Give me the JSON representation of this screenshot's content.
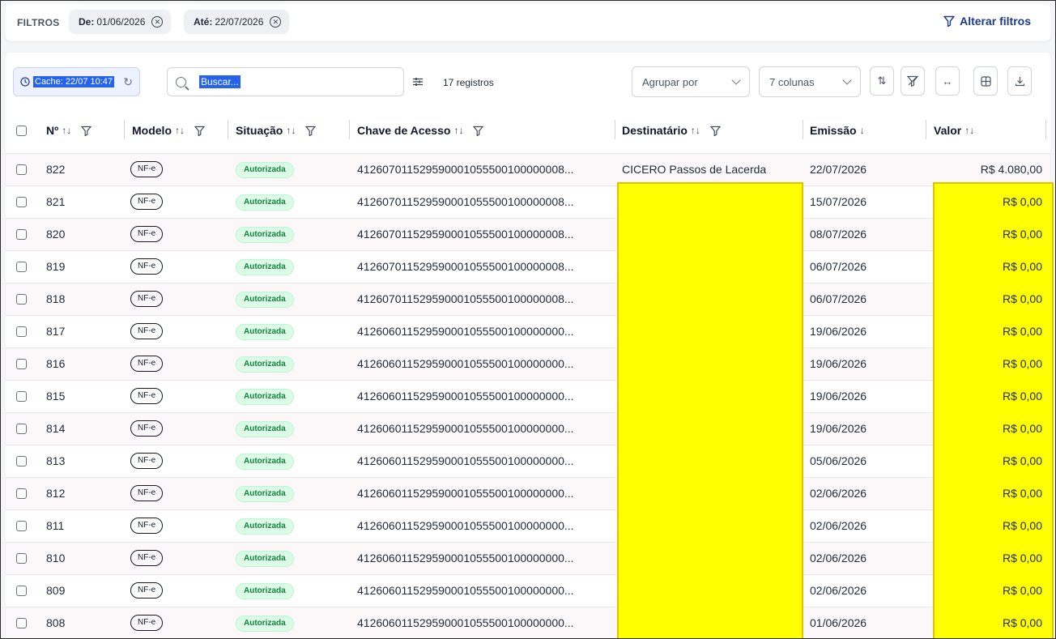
{
  "filters": {
    "label": "FILTROS",
    "chips": [
      {
        "prefix": "De:",
        "value": "01/06/2026"
      },
      {
        "prefix": "Até:",
        "value": "22/07/2026"
      }
    ],
    "change_label": "Alterar filtros"
  },
  "toolbar": {
    "cache_label": "Cache: 22/07 10:47",
    "search_placeholder": "Buscar...",
    "record_count": "17 registros",
    "group_by": "Agrupar por",
    "columns": "7 colunas"
  },
  "columns": [
    "Nº",
    "Modelo",
    "Situação",
    "Chave de Acesso",
    "Destinatário",
    "Emissão",
    "Valor"
  ],
  "rows": [
    {
      "num": "822",
      "modelo": "NF-e",
      "situacao": "Autorizada",
      "chave": "412607011529590001055500100000008...",
      "destinatario": "CICERO Passos de Lacerda",
      "emissao": "22/07/2026",
      "valor": "R$ 4.080,00"
    },
    {
      "num": "821",
      "modelo": "NF-e",
      "situacao": "Autorizada",
      "chave": "412607011529590001055500100000008...",
      "destinatario": "",
      "emissao": "15/07/2026",
      "valor": "R$ 0,00"
    },
    {
      "num": "820",
      "modelo": "NF-e",
      "situacao": "Autorizada",
      "chave": "412607011529590001055500100000008...",
      "destinatario": "",
      "emissao": "08/07/2026",
      "valor": "R$ 0,00"
    },
    {
      "num": "819",
      "modelo": "NF-e",
      "situacao": "Autorizada",
      "chave": "412607011529590001055500100000008...",
      "destinatario": "",
      "emissao": "06/07/2026",
      "valor": "R$ 0,00"
    },
    {
      "num": "818",
      "modelo": "NF-e",
      "situacao": "Autorizada",
      "chave": "412607011529590001055500100000008...",
      "destinatario": "",
      "emissao": "06/07/2026",
      "valor": "R$ 0,00"
    },
    {
      "num": "817",
      "modelo": "NF-e",
      "situacao": "Autorizada",
      "chave": "412606011529590001055500100000000...",
      "destinatario": "",
      "emissao": "19/06/2026",
      "valor": "R$ 0,00"
    },
    {
      "num": "816",
      "modelo": "NF-e",
      "situacao": "Autorizada",
      "chave": "412606011529590001055500100000000...",
      "destinatario": "",
      "emissao": "19/06/2026",
      "valor": "R$ 0,00"
    },
    {
      "num": "815",
      "modelo": "NF-e",
      "situacao": "Autorizada",
      "chave": "412606011529590001055500100000000...",
      "destinatario": "",
      "emissao": "19/06/2026",
      "valor": "R$ 0,00"
    },
    {
      "num": "814",
      "modelo": "NF-e",
      "situacao": "Autorizada",
      "chave": "412606011529590001055500100000000...",
      "destinatario": "",
      "emissao": "19/06/2026",
      "valor": "R$ 0,00"
    },
    {
      "num": "813",
      "modelo": "NF-e",
      "situacao": "Autorizada",
      "chave": "412606011529590001055500100000000...",
      "destinatario": "",
      "emissao": "05/06/2026",
      "valor": "R$ 0,00"
    },
    {
      "num": "812",
      "modelo": "NF-e",
      "situacao": "Autorizada",
      "chave": "412606011529590001055500100000000...",
      "destinatario": "",
      "emissao": "02/06/2026",
      "valor": "R$ 0,00"
    },
    {
      "num": "811",
      "modelo": "NF-e",
      "situacao": "Autorizada",
      "chave": "412606011529590001055500100000000...",
      "destinatario": "",
      "emissao": "02/06/2026",
      "valor": "R$ 0,00"
    },
    {
      "num": "810",
      "modelo": "NF-e",
      "situacao": "Autorizada",
      "chave": "412606011529590001055500100000000...",
      "destinatario": "",
      "emissao": "02/06/2026",
      "valor": "R$ 0,00"
    },
    {
      "num": "809",
      "modelo": "NF-e",
      "situacao": "Autorizada",
      "chave": "412606011529590001055500100000000...",
      "destinatario": "",
      "emissao": "02/06/2026",
      "valor": "R$ 0,00"
    },
    {
      "num": "808",
      "modelo": "NF-e",
      "situacao": "Autorizada",
      "chave": "412606011529590001055500100000000...",
      "destinatario": "",
      "emissao": "01/06/2026",
      "valor": "R$ 0,00"
    }
  ],
  "colors": {
    "highlight": "#ffff00",
    "accent": "#2563eb",
    "status_green": "#15803d"
  }
}
